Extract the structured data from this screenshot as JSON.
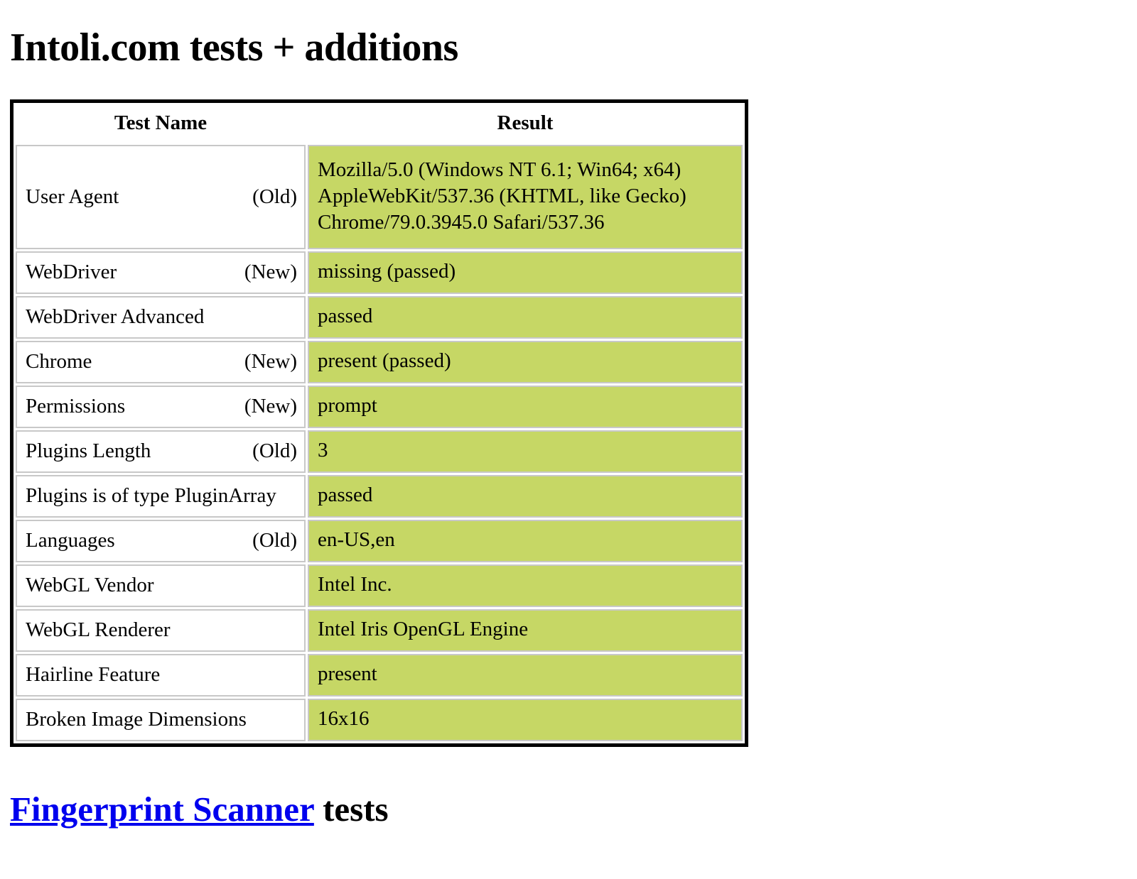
{
  "page": {
    "title": "Intoli.com tests + additions"
  },
  "table": {
    "headers": {
      "name": "Test Name",
      "result": "Result"
    },
    "rows": [
      {
        "name": "User Agent",
        "tag": "(Old)",
        "result_lines": [
          "Mozilla/5.0 (Windows NT 6.1; Win64; x64)",
          "AppleWebKit/537.36 (KHTML, like Gecko)",
          "Chrome/79.0.3945.0 Safari/537.36"
        ],
        "result": "Mozilla/5.0 (Windows NT 6.1; Win64; x64) AppleWebKit/537.36 (KHTML, like Gecko) Chrome/79.0.3945.0 Safari/537.36",
        "tall": true
      },
      {
        "name": "WebDriver",
        "tag": "(New)",
        "result": "missing (passed)",
        "tall": false
      },
      {
        "name": "WebDriver Advanced",
        "tag": "",
        "result": "passed",
        "tall": false
      },
      {
        "name": "Chrome",
        "tag": "(New)",
        "result": "present (passed)",
        "tall": false
      },
      {
        "name": "Permissions",
        "tag": "(New)",
        "result": "prompt",
        "tall": false
      },
      {
        "name": "Plugins Length",
        "tag": "(Old)",
        "result": "3",
        "tall": false
      },
      {
        "name": "Plugins is of type PluginArray",
        "tag": "",
        "result": "passed",
        "tall": false
      },
      {
        "name": "Languages",
        "tag": "(Old)",
        "result": "en-US,en",
        "tall": false
      },
      {
        "name": "WebGL Vendor",
        "tag": "",
        "result": "Intel Inc.",
        "tall": false
      },
      {
        "name": "WebGL Renderer",
        "tag": "",
        "result": "Intel Iris OpenGL Engine",
        "tall": false
      },
      {
        "name": "Hairline Feature",
        "tag": "",
        "result": "present",
        "tall": false
      },
      {
        "name": "Broken Image Dimensions",
        "tag": "",
        "result": "16x16",
        "tall": false
      }
    ]
  },
  "section": {
    "link_text": "Fingerprint Scanner",
    "suffix": " tests"
  },
  "colors": {
    "pass_background": "#c6d765",
    "table_border": "#000000",
    "cell_border": "#c8c8c8",
    "link": "#0000ee",
    "text": "#000000"
  }
}
